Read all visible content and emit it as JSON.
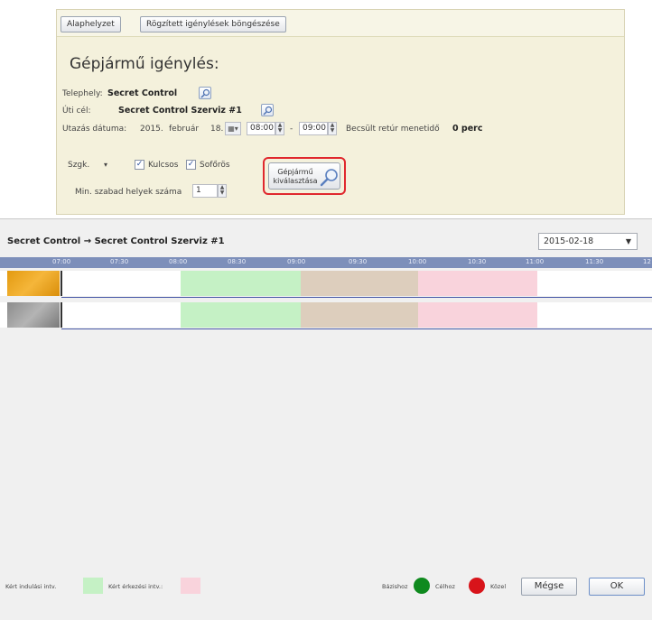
{
  "toolbar": {
    "reset_label": "Alaphelyzet",
    "browse_label": "Rögzített igénylések böngészése"
  },
  "form": {
    "title": "Gépjármű igénylés:",
    "site_label": "Telephely:",
    "site_value": "Secret Control",
    "destination_label": "Úti cél:",
    "destination_value": "Secret Control Szerviz #1",
    "date_label": "Utazás dátuma:",
    "date_year": "2015.",
    "date_month": "február",
    "date_day": "18.",
    "time_from": "08:00",
    "time_separator": "-",
    "time_to": "09:00",
    "return_label": "Becsült retúr menetidő",
    "return_value": "0 perc",
    "type_select": "Szgk.",
    "key_label": "Kulcsos",
    "driver_label": "Sofőrös",
    "min_seats_label": "Min. szabad helyek száma",
    "min_seats_value": "1",
    "select_vehicle_label": "Gépjármű kiválasztása"
  },
  "scheduler": {
    "route_from": "Secret Control",
    "route_arrow": "→",
    "route_to": "Secret Control Szerviz #1",
    "date_value": "2015-02-18",
    "ticks": [
      "07:00",
      "07:30",
      "08:00",
      "08:30",
      "09:00",
      "09:30",
      "10:00",
      "10:30",
      "11:00",
      "11:30",
      "12"
    ]
  },
  "footer": {
    "legend_departure": "Kért indulási intv.",
    "legend_arrival": "Kért érkezési intv.:",
    "legend_base": "Bázishoz",
    "legend_target": "Célhoz",
    "legend_near": "Közel",
    "cancel_label": "Mégse",
    "ok_label": "OK"
  },
  "colors": {
    "departure_interval": "#c5f1c5",
    "arrival_interval": "#f9d3dc",
    "base_dot": "#0f8a1e",
    "target_dot": "#d8141a",
    "highlight_border": "#e0282e"
  },
  "icons": {
    "lookup": "magnifier-icon",
    "calendar": "calendar-icon"
  }
}
